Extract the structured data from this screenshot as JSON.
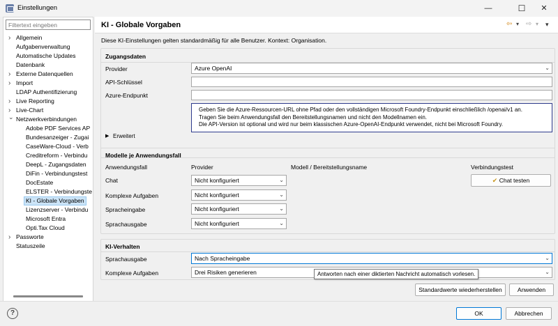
{
  "window": {
    "title": "Einstellungen",
    "controls": {
      "minimize": "—",
      "maximize": "☐",
      "close": "✕"
    }
  },
  "sidebar": {
    "filter_placeholder": "Filtertext eingeben",
    "items": [
      {
        "label": "Allgemein",
        "level": 0,
        "expandable": true,
        "expanded": false
      },
      {
        "label": "Aufgabenverwaltung",
        "level": 0,
        "expandable": false
      },
      {
        "label": "Automatische Updates",
        "level": 0,
        "expandable": false
      },
      {
        "label": "Datenbank",
        "level": 0,
        "expandable": false
      },
      {
        "label": "Externe Datenquellen",
        "level": 0,
        "expandable": true,
        "expanded": false
      },
      {
        "label": "Import",
        "level": 0,
        "expandable": true,
        "expanded": false
      },
      {
        "label": "LDAP Authentifizierung",
        "level": 0,
        "expandable": false
      },
      {
        "label": "Live Reporting",
        "level": 0,
        "expandable": true,
        "expanded": false
      },
      {
        "label": "Live-Chart",
        "level": 0,
        "expandable": true,
        "expanded": false
      },
      {
        "label": "Netzwerkverbindungen",
        "level": 0,
        "expandable": true,
        "expanded": true
      },
      {
        "label": "Adobe PDF Services AP",
        "level": 1
      },
      {
        "label": "Bundesanzeiger - Zugai",
        "level": 1
      },
      {
        "label": "CaseWare-Cloud - Verb",
        "level": 1
      },
      {
        "label": "Creditreform - Verbindu",
        "level": 1
      },
      {
        "label": "DeepL - Zugangsdaten",
        "level": 1
      },
      {
        "label": "DiFin - Verbindungstest",
        "level": 1
      },
      {
        "label": "DocEstate",
        "level": 1
      },
      {
        "label": "ELSTER - Verbindungste",
        "level": 1
      },
      {
        "label": "KI - Globale Vorgaben",
        "level": 1,
        "selected": true
      },
      {
        "label": "Lizenzserver - Verbindu",
        "level": 1
      },
      {
        "label": "Microsoft Entra",
        "level": 1
      },
      {
        "label": "Opti.Tax Cloud",
        "level": 1
      },
      {
        "label": "Passworte",
        "level": 0,
        "expandable": true,
        "expanded": false
      },
      {
        "label": "Statuszeile",
        "level": 0,
        "expandable": false
      }
    ]
  },
  "header": {
    "title": "KI - Globale Vorgaben",
    "nav": {
      "back": "⇦",
      "back_menu": "▾",
      "forward": "⇨",
      "forward_menu": "▾",
      "view_menu": "▾"
    }
  },
  "description": "Diese KI-Einstellungen gelten standardmäßig für alle Benutzer. Kontext: Organisation.",
  "zugangsdaten": {
    "title": "Zugangsdaten",
    "provider_label": "Provider",
    "provider_value": "Azure OpenAI",
    "api_key_label": "API-Schlüssel",
    "api_key_value": "",
    "endpoint_label": "Azure-Endpunkt",
    "endpoint_value": "",
    "info_lines": [
      "Geben Sie die Azure-Ressourcen-URL ohne Pfad oder den vollständigen Microsoft Foundry-Endpunkt einschließlich /openai/v1 an.",
      "Tragen Sie beim Anwendungsfall den Bereitstellungsnamen und nicht den Modellnamen ein.",
      "Die API-Version ist optional und wird nur beim klassischen Azure-OpenAI-Endpunkt verwendet, nicht bei Microsoft Foundry."
    ],
    "advanced_label": "Erweitert"
  },
  "modelle": {
    "title": "Modelle je Anwendungsfall",
    "columns": {
      "usecase": "Anwendungsfall",
      "provider": "Provider",
      "model": "Modell / Bereitstellungsname",
      "test": "Verbindungstest"
    },
    "rows": [
      {
        "usecase": "Chat",
        "provider": "Nicht konfiguriert"
      },
      {
        "usecase": "Komplexe Aufgaben",
        "provider": "Nicht konfiguriert"
      },
      {
        "usecase": "Spracheingabe",
        "provider": "Nicht konfiguriert"
      },
      {
        "usecase": "Sprachausgabe",
        "provider": "Nicht konfiguriert"
      }
    ],
    "chat_test_label": "Chat testen"
  },
  "verhalten": {
    "title": "KI-Verhalten",
    "speech_output_label": "Sprachausgabe",
    "speech_output_value": "Nach Spracheingabe",
    "complex_label": "Komplexe Aufgaben",
    "complex_value": "Drei Risiken generieren",
    "tooltip": "Antworten nach einer diktierten Nachricht automatisch vorlesen."
  },
  "page_buttons": {
    "restore_defaults": "Standardwerte wiederherstellen",
    "apply": "Anwenden"
  },
  "dialog_buttons": {
    "help": "?",
    "ok": "OK",
    "cancel": "Abbrechen"
  },
  "colors": {
    "accent": "#0078d7",
    "selection": "#cce4f7",
    "info_border": "#2d3a8c",
    "nav_arrow": "#d48c1f"
  }
}
